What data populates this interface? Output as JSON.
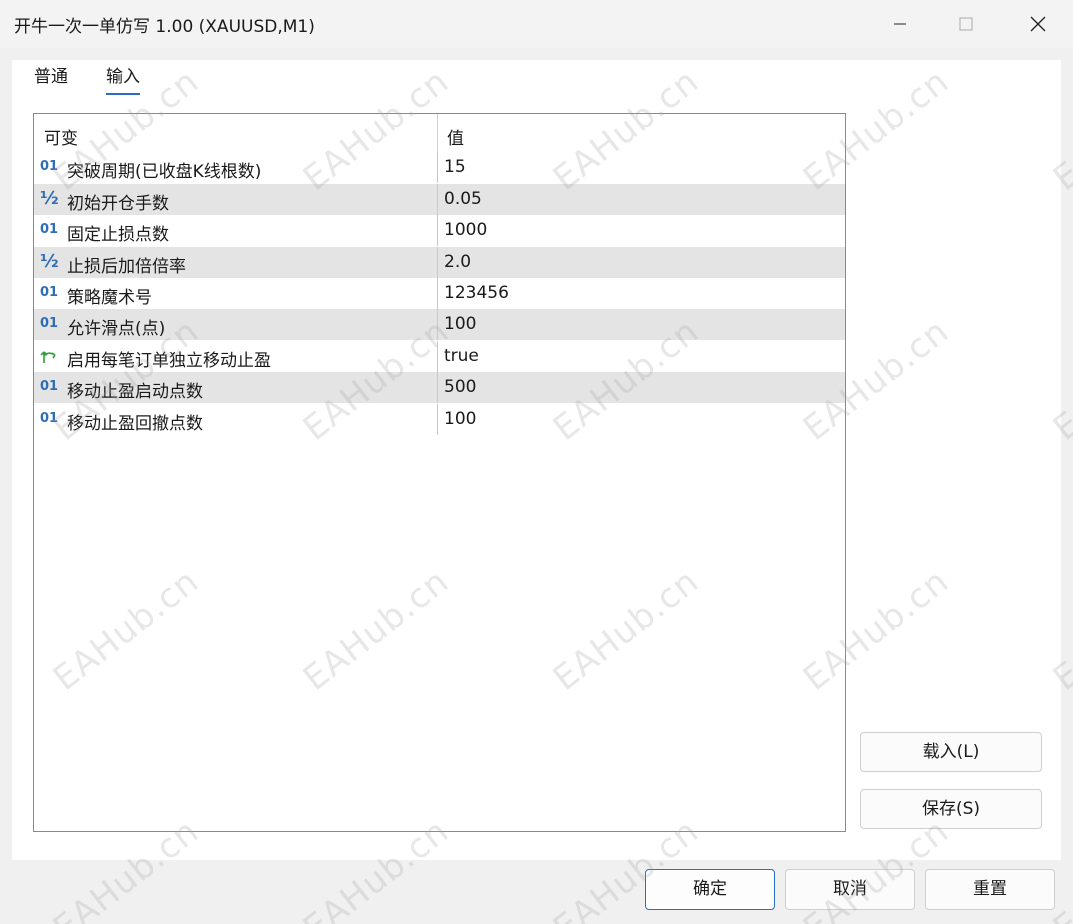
{
  "window": {
    "title": "开牛一次一单仿写 1.00 (XAUUSD,M1)"
  },
  "tabs": [
    {
      "label": "普通"
    },
    {
      "label": "输入"
    }
  ],
  "grid": {
    "headers": {
      "variable": "可变",
      "value": "值"
    },
    "rows": [
      {
        "icon": "01",
        "name": "突破周期(已收盘K线根数)",
        "value": "15"
      },
      {
        "icon": "½",
        "name": "初始开仓手数",
        "value": "0.05"
      },
      {
        "icon": "01",
        "name": "固定止损点数",
        "value": "1000"
      },
      {
        "icon": "½",
        "name": "止损后加倍倍率",
        "value": "2.0"
      },
      {
        "icon": "01",
        "name": "策略魔术号",
        "value": "123456"
      },
      {
        "icon": "01",
        "name": "允许滑点(点)",
        "value": "100"
      },
      {
        "icon": "bool",
        "name": "启用每笔订单独立移动止盈",
        "value": "true"
      },
      {
        "icon": "01",
        "name": "移动止盈启动点数",
        "value": "500"
      },
      {
        "icon": "01",
        "name": "移动止盈回撤点数",
        "value": "100"
      }
    ]
  },
  "buttons": {
    "load": "载入(L)",
    "save": "保存(S)",
    "ok": "确定",
    "cancel": "取消",
    "reset": "重置"
  },
  "watermark": "EAHub.cn",
  "colors": {
    "accent": "#2b6cc4",
    "int_icon": "#2f6db5",
    "bool_icon": "#2e9e3a",
    "alt_row": "#e4e4e4"
  }
}
